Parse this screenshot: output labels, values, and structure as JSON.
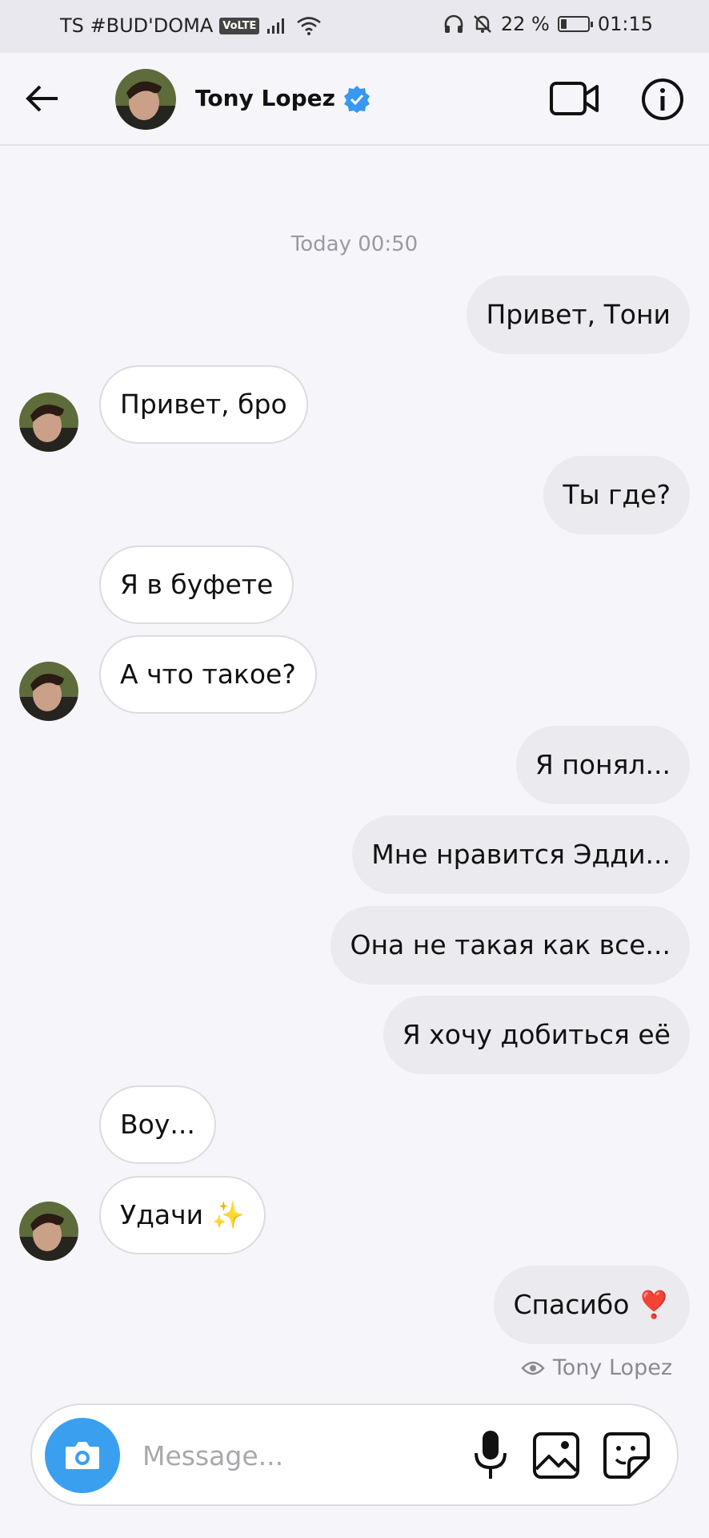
{
  "status_bar": {
    "carrier": "TS #BUD'DOMA",
    "volte": "VoLTE",
    "battery": "22 %",
    "battery_level": 0.22,
    "time": "01:15"
  },
  "header": {
    "contact_name": "Tony Lopez",
    "verified": true
  },
  "conversation": {
    "timestamp": "Today 00:50",
    "messages": [
      {
        "direction": "out",
        "text": "Привет, Тони"
      },
      {
        "direction": "in",
        "text": "Привет, бро",
        "avatar": true
      },
      {
        "direction": "out",
        "text": "Ты где?"
      },
      {
        "direction": "in",
        "text": "Я в буфете",
        "avatar": false
      },
      {
        "direction": "in",
        "text": "А что такое?",
        "avatar": true
      },
      {
        "direction": "out",
        "text": "Я понял..."
      },
      {
        "direction": "out",
        "text": "Мне нравится Эдди..."
      },
      {
        "direction": "out",
        "text": "Она не такая как все..."
      },
      {
        "direction": "out",
        "text": "Я хочу добиться её"
      },
      {
        "direction": "in",
        "text": "Воу...",
        "avatar": false
      },
      {
        "direction": "in",
        "text": "Удачи ✨",
        "avatar": true
      },
      {
        "direction": "out",
        "text": "Спасибо ❣️"
      }
    ],
    "seen_by": "Tony Lopez"
  },
  "composer": {
    "placeholder": "Message..."
  },
  "colors": {
    "accent": "#3b9ff0",
    "verified_badge": "#3897f0",
    "outgoing_bubble": "#ebeaef",
    "incoming_bubble": "#ffffff"
  },
  "icons": {
    "back": "arrow-left-icon",
    "video": "video-camera-icon",
    "info": "info-icon",
    "camera": "camera-icon",
    "mic": "microphone-icon",
    "gallery": "image-icon",
    "sticker": "sticker-icon"
  }
}
